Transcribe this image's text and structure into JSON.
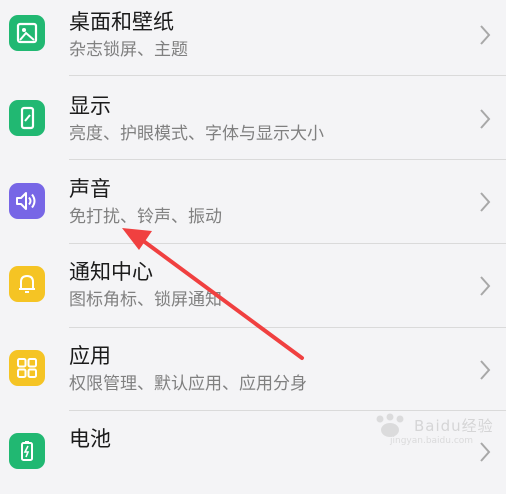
{
  "settings": {
    "items": [
      {
        "title": "桌面和壁纸",
        "subtitle": "杂志锁屏、主题",
        "icon": "wallpaper-icon",
        "color": "#21b872"
      },
      {
        "title": "显示",
        "subtitle": "亮度、护眼模式、字体与显示大小",
        "icon": "display-icon",
        "color": "#21b872"
      },
      {
        "title": "声音",
        "subtitle": "免打扰、铃声、振动",
        "icon": "sound-icon",
        "color": "#7766e6"
      },
      {
        "title": "通知中心",
        "subtitle": "图标角标、锁屏通知",
        "icon": "bell-icon",
        "color": "#f5c424"
      },
      {
        "title": "应用",
        "subtitle": "权限管理、默认应用、应用分身",
        "icon": "apps-icon",
        "color": "#f5c424"
      },
      {
        "title": "电池",
        "subtitle": "",
        "icon": "battery-icon",
        "color": "#21b872"
      }
    ]
  },
  "annotation": {
    "color": "#f04040"
  },
  "watermark": {
    "text": "Baidu经验",
    "sub": "jingyan.baidu.com"
  }
}
